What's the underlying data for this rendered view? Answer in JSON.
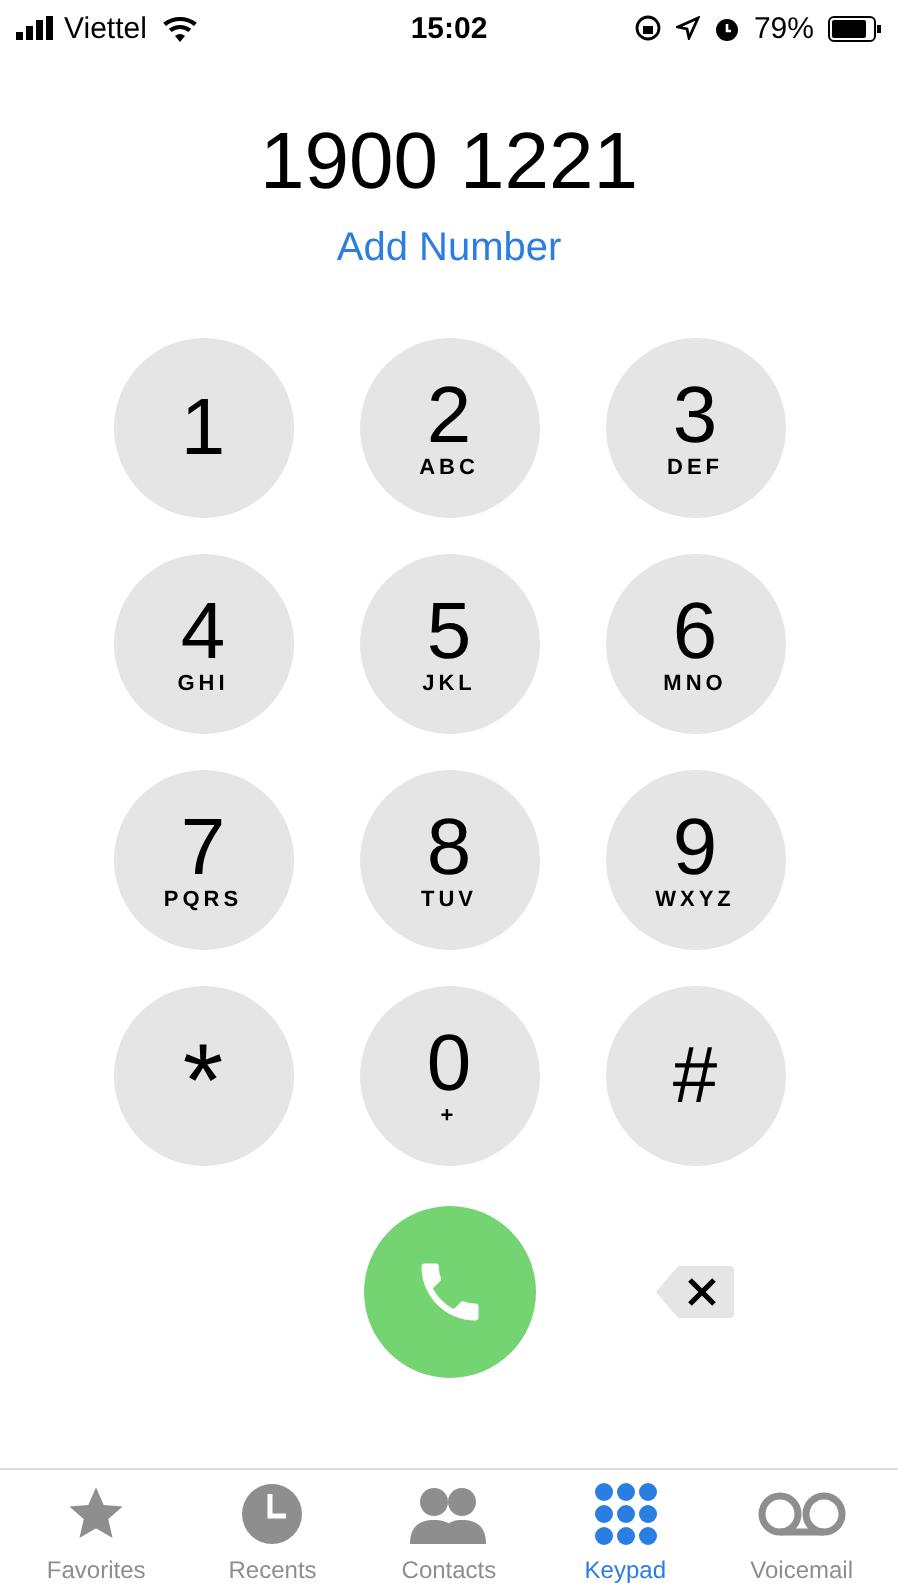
{
  "status_bar": {
    "carrier": "Viettel",
    "time": "15:02",
    "battery": "79%"
  },
  "number": "1900 1221",
  "add_number": "Add Number",
  "keys": [
    {
      "digit": "1"
    },
    {
      "digit": "2",
      "letters": "ABC"
    },
    {
      "digit": "3",
      "letters": "DEF"
    },
    {
      "digit": "4",
      "letters": "GHI"
    },
    {
      "digit": "5",
      "letters": "JKL"
    },
    {
      "digit": "6",
      "letters": "MNO"
    },
    {
      "digit": "7",
      "letters": "PQRS"
    },
    {
      "digit": "8",
      "letters": "TUV"
    },
    {
      "digit": "9",
      "letters": "WXYZ"
    },
    {
      "digit": "*"
    },
    {
      "digit": "0",
      "letters": "+"
    },
    {
      "digit": "#"
    }
  ],
  "tabs": [
    {
      "label": "Favorites",
      "selected": false
    },
    {
      "label": "Recents",
      "selected": false
    },
    {
      "label": "Contacts",
      "selected": false
    },
    {
      "label": "Keypad",
      "selected": true
    },
    {
      "label": "Voicemail",
      "selected": false
    }
  ]
}
